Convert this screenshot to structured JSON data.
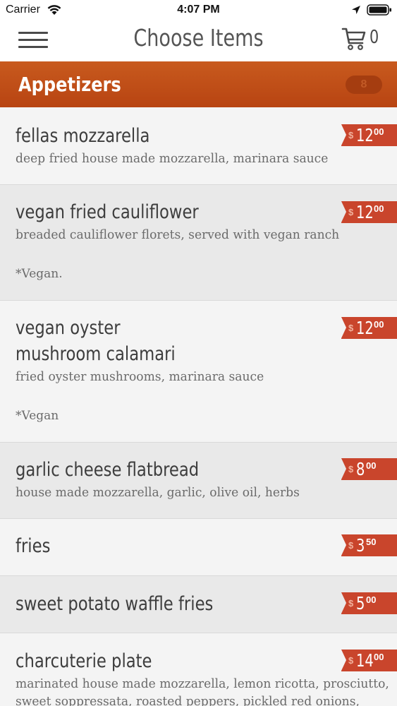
{
  "status_bar": {
    "carrier": "Carrier",
    "time": "4:07 PM"
  },
  "nav": {
    "title": "Choose Items",
    "cart_count": "0"
  },
  "section": {
    "title": "Appetizers",
    "count": "8"
  },
  "colors": {
    "accent": "#c0501a",
    "price_tag": "#c9452c"
  },
  "icons": [
    "wifi-icon",
    "location-arrow-icon",
    "battery-icon",
    "hamburger-menu-icon",
    "shopping-cart-icon"
  ],
  "items": [
    {
      "name": "fellas mozzarella",
      "description": "deep fried house made mozzarella, marinara sauce",
      "price_currency": "$",
      "price_dollars": "12",
      "price_cents": "00"
    },
    {
      "name": "vegan fried cauliflower",
      "description": "breaded cauliflower florets, served with vegan ranch",
      "note": "*Vegan.",
      "price_currency": "$",
      "price_dollars": "12",
      "price_cents": "00"
    },
    {
      "name": "vegan oyster\nmushroom calamari",
      "description": "fried oyster mushrooms, marinara sauce",
      "note": "*Vegan",
      "price_currency": "$",
      "price_dollars": "12",
      "price_cents": "00"
    },
    {
      "name": "garlic cheese flatbread",
      "description": "house made mozzarella, garlic, olive oil, herbs",
      "price_currency": "$",
      "price_dollars": "8",
      "price_cents": "00"
    },
    {
      "name": "fries",
      "price_currency": "$",
      "price_dollars": "3",
      "price_cents": "50"
    },
    {
      "name": "sweet potato waffle fries",
      "price_currency": "$",
      "price_dollars": "5",
      "price_cents": "00"
    },
    {
      "name": "charcuterie plate",
      "description": "marinated house made mozzarella, lemon ricotta, prosciutto,",
      "description_line2": "sweet soppressata, roasted peppers, pickled red onions,",
      "price_currency": "$",
      "price_dollars": "14",
      "price_cents": "00"
    }
  ]
}
